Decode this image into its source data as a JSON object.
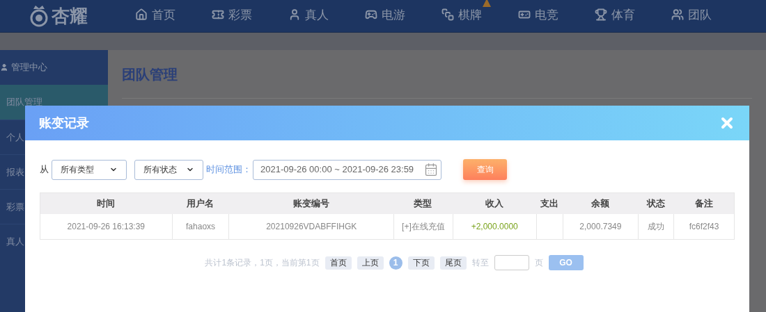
{
  "nav": {
    "logo": "杏耀",
    "items": [
      {
        "label": "首页",
        "badge": false
      },
      {
        "label": "彩票",
        "badge": false
      },
      {
        "label": "真人",
        "badge": false
      },
      {
        "label": "电游",
        "badge": false
      },
      {
        "label": "棋牌",
        "badge": true
      },
      {
        "label": "电竞",
        "badge": false
      },
      {
        "label": "体育",
        "badge": false
      },
      {
        "label": "团队",
        "badge": false
      }
    ]
  },
  "sidebar": {
    "header": "管理中心",
    "items": [
      {
        "label": "团队管理",
        "selected": true
      },
      {
        "label": "个人",
        "selected": false
      },
      {
        "label": "报表",
        "selected": false
      },
      {
        "label": "彩票",
        "selected": false
      },
      {
        "label": "真人",
        "selected": false
      }
    ]
  },
  "content": {
    "title": "团队管理"
  },
  "dialog": {
    "title": "账变记录",
    "filters": {
      "prefix": "从",
      "selects": [
        {
          "value": "所有类型"
        },
        {
          "value": "所有状态"
        }
      ],
      "range_label": "时间范围：",
      "date_range": "2021-09-26 00:00 ~ 2021-09-26 23:59",
      "query_button": "查询"
    },
    "table": {
      "columns": [
        "时间",
        "用户名",
        "账变编号",
        "类型",
        "收入",
        "支出",
        "余额",
        "状态",
        "备注"
      ],
      "rows": [
        {
          "cells": [
            "2021-09-26 16:13:39",
            "fahaoxs",
            "20210926VDABFFIHGK",
            "[+]在线充值",
            "+2,000.0000",
            "",
            "2,000.7349",
            "成功",
            "fc6f2f43"
          ]
        }
      ]
    },
    "pagination": {
      "summary": "共计1条记录，1页，当前第1页",
      "buttons": [
        {
          "label": "首页",
          "kind": "page",
          "selected": false
        },
        {
          "label": "上页",
          "kind": "page",
          "selected": false
        },
        {
          "label": "1",
          "kind": "number",
          "selected": true
        },
        {
          "label": "下页",
          "kind": "page",
          "selected": false
        },
        {
          "label": "尾页",
          "kind": "page",
          "selected": false
        }
      ],
      "goto_label": "转至",
      "page_suffix": "页",
      "go_button": "GO"
    }
  }
}
